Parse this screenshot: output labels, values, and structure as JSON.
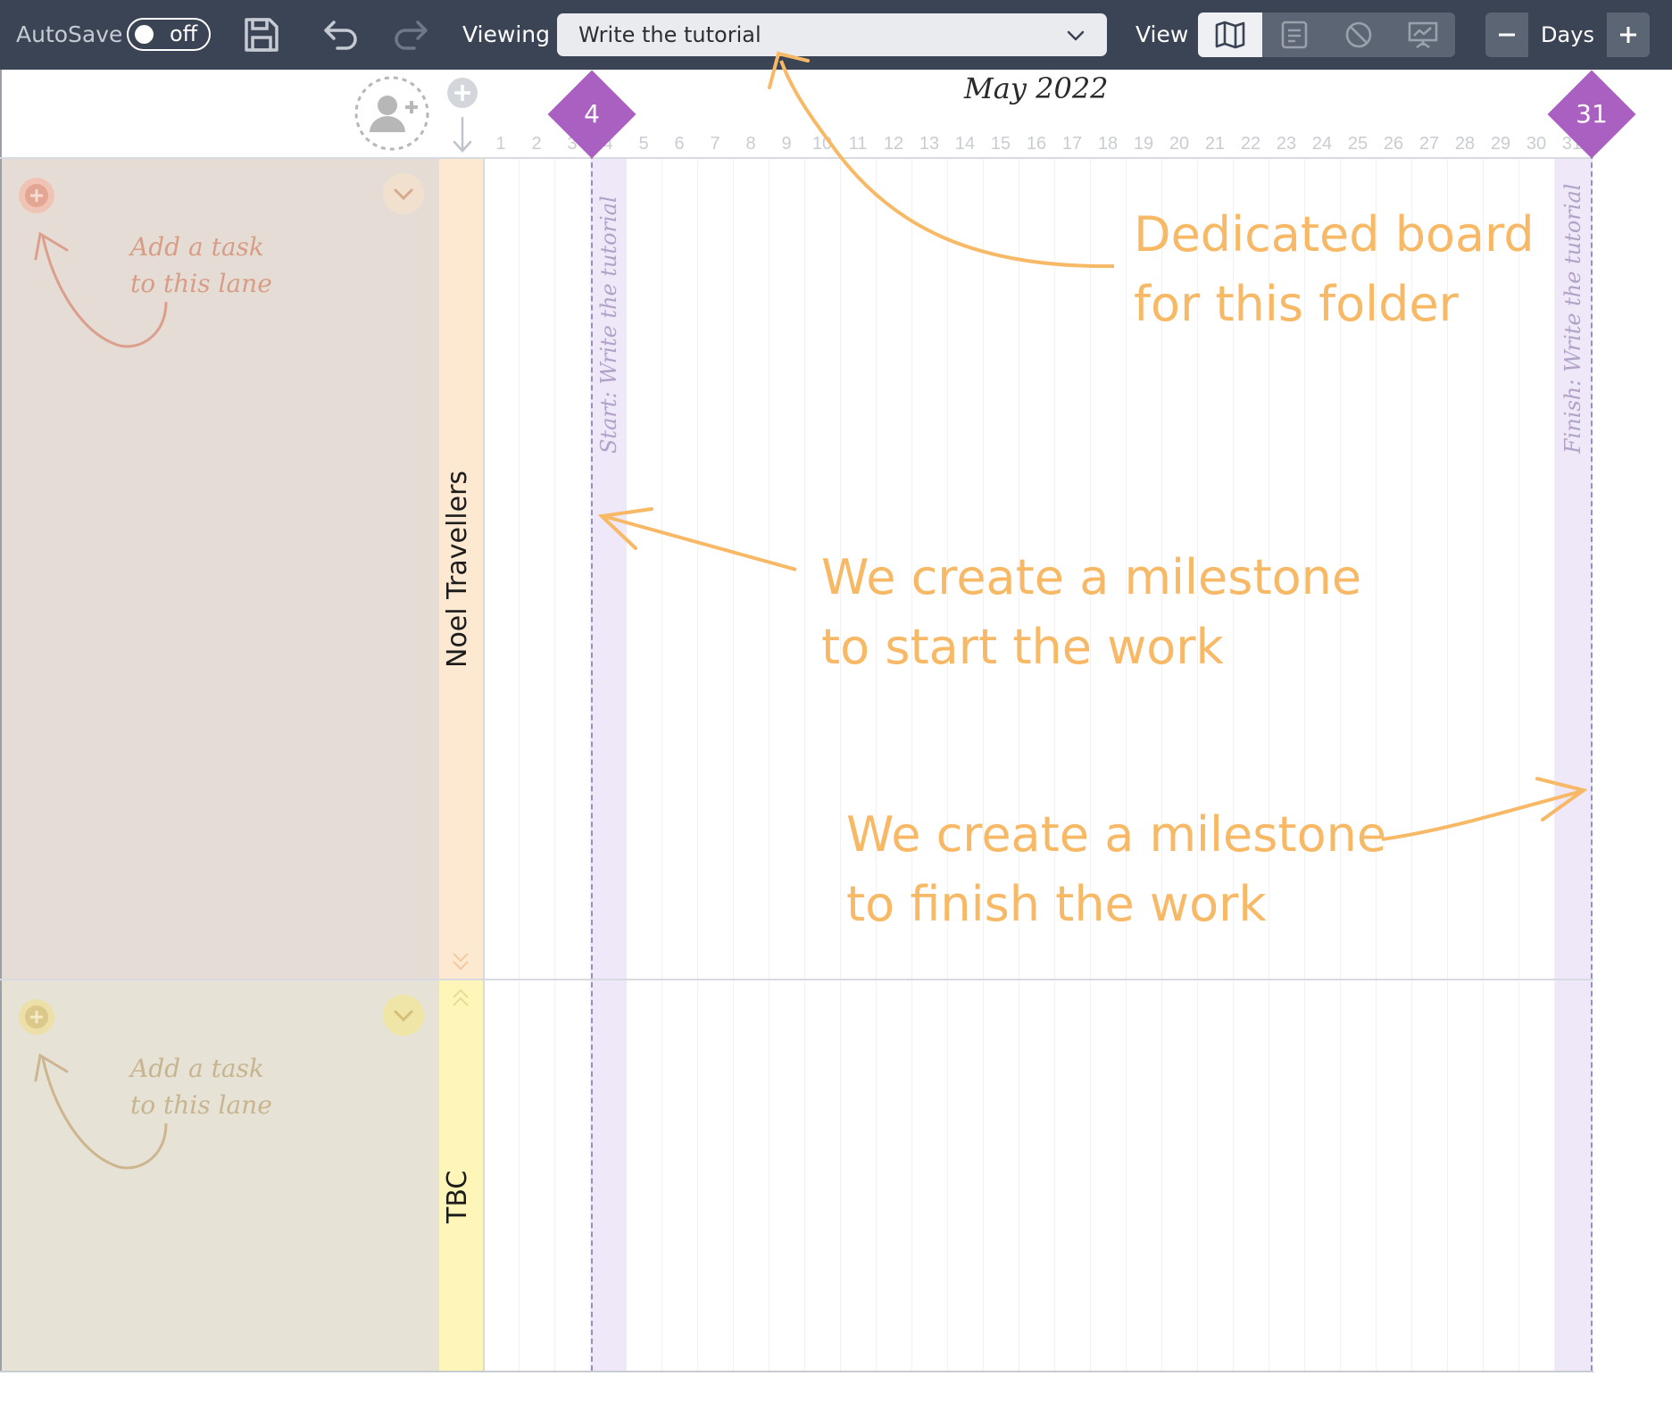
{
  "toolbar": {
    "autosave_label": "AutoSave",
    "autosave_state": "off",
    "viewing_label": "Viewing",
    "viewing_value": "Write the tutorial",
    "view_label": "View",
    "view_modes": [
      "map-icon",
      "list-icon",
      "blocked-icon",
      "presentation-icon"
    ],
    "active_view": "map-icon",
    "zoom_label": "Days"
  },
  "timeline": {
    "month": "May 2022",
    "days": [
      "1",
      "2",
      "3",
      "4",
      "5",
      "6",
      "7",
      "8",
      "9",
      "10",
      "11",
      "12",
      "13",
      "14",
      "15",
      "16",
      "17",
      "18",
      "19",
      "20",
      "21",
      "22",
      "23",
      "24",
      "25",
      "26",
      "27",
      "28",
      "29",
      "30",
      "31"
    ]
  },
  "lanes": [
    {
      "name": "Noel Travellers",
      "hint_line1": "Add a task",
      "hint_line2": "to this lane"
    },
    {
      "name": "TBC",
      "hint_line1": "Add a task",
      "hint_line2": "to this lane"
    }
  ],
  "milestones": [
    {
      "day": "4",
      "label": "Start: Write the tutorial"
    },
    {
      "day": "31",
      "label": "Finish: Write the tutorial"
    }
  ],
  "annotations": {
    "board_line1": "Dedicated board",
    "board_line2": "for this folder",
    "start_line1": "We create a milestone",
    "start_line2": "to start the work",
    "finish_line1": "We create a milestone",
    "finish_line2": "to finish the work"
  },
  "colors": {
    "toolbar": "#3b4454",
    "milestone": "#a960c1",
    "annotation": "#f8b967",
    "lane1_strip": "#fde9d2",
    "lane2_strip": "#fdf6b8"
  }
}
